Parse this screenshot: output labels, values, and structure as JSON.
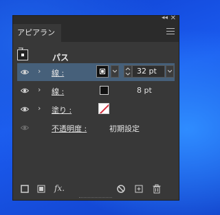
{
  "panel": {
    "tab_title": "アピアランス",
    "collapse_icon": "double-chevron-left-icon",
    "close_icon": "close-icon",
    "menu_icon": "hamburger-menu-icon"
  },
  "object": {
    "label": "パス"
  },
  "rows": [
    {
      "label": "線 :",
      "value": "32 pt",
      "selected": true
    },
    {
      "label": "線 :",
      "value": "8 pt",
      "selected": false
    },
    {
      "label": "塗り :",
      "value": "",
      "selected": false
    },
    {
      "label": "不透明度 :",
      "value": "初期設定",
      "selected": false
    }
  ],
  "footer": {
    "fx_label": "fx.",
    "icons": [
      "add-new-stroke-icon",
      "add-new-fill-icon",
      "add-new-effect-icon",
      "clear-appearance-icon",
      "duplicate-item-icon",
      "delete-icon"
    ]
  },
  "colors": {
    "panel_bg": "#383838",
    "selected_row": "#46607a",
    "fill_slash": "#d32b3a"
  }
}
